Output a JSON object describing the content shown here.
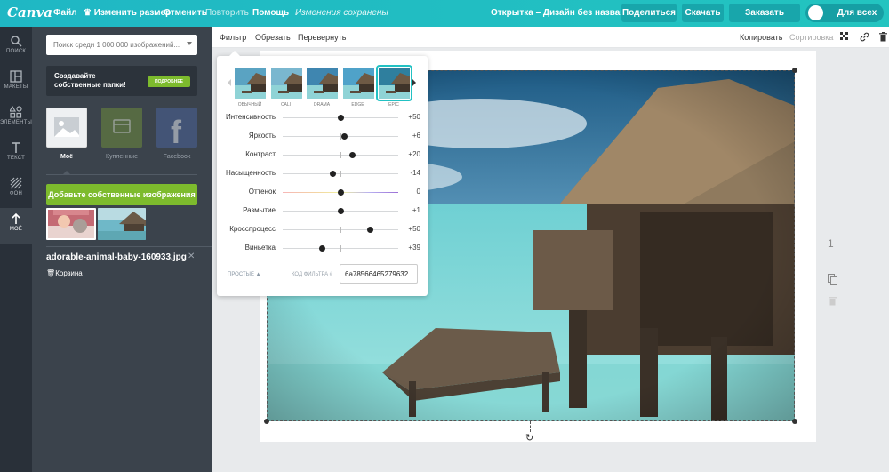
{
  "app": {
    "logo": "Canva",
    "menu": {
      "file": "Файл",
      "resize": "Изменить размер",
      "undo": "Отменить",
      "redo": "Повторить",
      "help": "Помощь",
      "saved_status": "Изменения сохранены"
    },
    "doc_title": "Открытка – Дизайн без названия",
    "buttons": {
      "share": "Поделиться",
      "download": "Скачать",
      "order_print": "Заказать печать"
    },
    "visibility_toggle": "Для всех"
  },
  "rail": {
    "items": [
      {
        "label": "Поиск",
        "icon": "search-icon"
      },
      {
        "label": "Макеты",
        "icon": "layouts-icon"
      },
      {
        "label": "Элементы",
        "icon": "elements-icon"
      },
      {
        "label": "Текст",
        "icon": "text-icon"
      },
      {
        "label": "Фон",
        "icon": "background-icon"
      },
      {
        "label": "Моё",
        "icon": "upload-icon",
        "active": true
      }
    ]
  },
  "panel": {
    "search_placeholder": "Поиск среди 1 000 000 изображений...",
    "promo_text": "Создавайте собственные папки!",
    "promo_button": "Подробнее",
    "sources": [
      {
        "label": "Моё",
        "active": true
      },
      {
        "label": "Купленные",
        "active": false
      },
      {
        "label": "Facebook",
        "active": false
      }
    ],
    "upload_button": "Добавьте собственные изображения",
    "selected_file": "adorable-animal-baby-160933.jpg",
    "trash_label": "Корзина"
  },
  "toolbar": {
    "filter": "Фильтр",
    "crop": "Обрезать",
    "flip": "Перевернуть",
    "copy": "Копировать",
    "sort": "Сортировка"
  },
  "filter": {
    "presets": [
      {
        "label": "Обычный",
        "active": false
      },
      {
        "label": "Cali",
        "active": false
      },
      {
        "label": "Drama",
        "active": false
      },
      {
        "label": "Edge",
        "active": false
      },
      {
        "label": "Epic",
        "active": true
      }
    ],
    "sliders": [
      {
        "name": "Интенсивность",
        "value": "+50",
        "position": 0.5
      },
      {
        "name": "Яркость",
        "value": "+6",
        "position": 0.53
      },
      {
        "name": "Контраст",
        "value": "+20",
        "position": 0.6
      },
      {
        "name": "Насыщенность",
        "value": "-14",
        "position": 0.43
      },
      {
        "name": "Оттенок",
        "value": "0",
        "position": 0.5
      },
      {
        "name": "Размытие",
        "value": "+1",
        "position": 0.5
      },
      {
        "name": "Кросспроцесс",
        "value": "+50",
        "position": 0.75
      },
      {
        "name": "Виньетка",
        "value": "+39",
        "position": 0.34
      }
    ],
    "simple_link": "Простые ▲",
    "code_label": "Код фильтра #",
    "code_value": "6a78566465279632"
  },
  "canvas": {
    "page_number": "1"
  },
  "colors": {
    "brand": "#22c1c3",
    "green": "#7dbb2d",
    "panel": "#3b434c",
    "rail": "#293039"
  }
}
